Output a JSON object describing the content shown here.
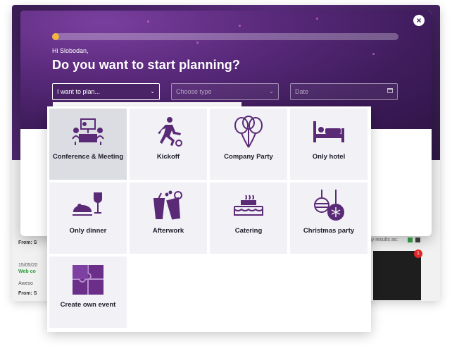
{
  "background": {
    "from_label_1": "From: S",
    "date_text": "15/05/20",
    "web_text": "Web co",
    "awesome_text": "Aweso",
    "from_label_2": "From: S",
    "display_text": "splay results as:",
    "badge_count": "1"
  },
  "modal": {
    "close_glyph": "×",
    "progress": 0.02,
    "greeting": "Hi Slobodan,",
    "title": "Do you want to start planning?"
  },
  "form": {
    "plan_label": "I want to plan...",
    "type_placeholder": "Choose type",
    "date_placeholder": "Date"
  },
  "icons": {
    "chevron": "chevron-down-icon",
    "calendar": "calendar-icon"
  },
  "colors": {
    "accent": "#5a2a7c",
    "progress": "#f4b63c",
    "tile_bg": "#f1f1f6",
    "tile_selected": "#dcdde3"
  },
  "event_types": [
    {
      "label": "Conference & Meeting",
      "icon": "conference-icon",
      "selected": true
    },
    {
      "label": "Kickoff",
      "icon": "kickoff-icon",
      "selected": false
    },
    {
      "label": "Company Party",
      "icon": "balloons-icon",
      "selected": false
    },
    {
      "label": "Only hotel",
      "icon": "bed-icon",
      "selected": false
    },
    {
      "label": "Only dinner",
      "icon": "dinner-icon",
      "selected": false
    },
    {
      "label": "Afterwork",
      "icon": "drinks-icon",
      "selected": false
    },
    {
      "label": "Catering",
      "icon": "catering-icon",
      "selected": false
    },
    {
      "label": "Christmas party",
      "icon": "ornaments-icon",
      "selected": false
    },
    {
      "label": "Create own event",
      "icon": "puzzle-icon",
      "selected": false
    }
  ]
}
